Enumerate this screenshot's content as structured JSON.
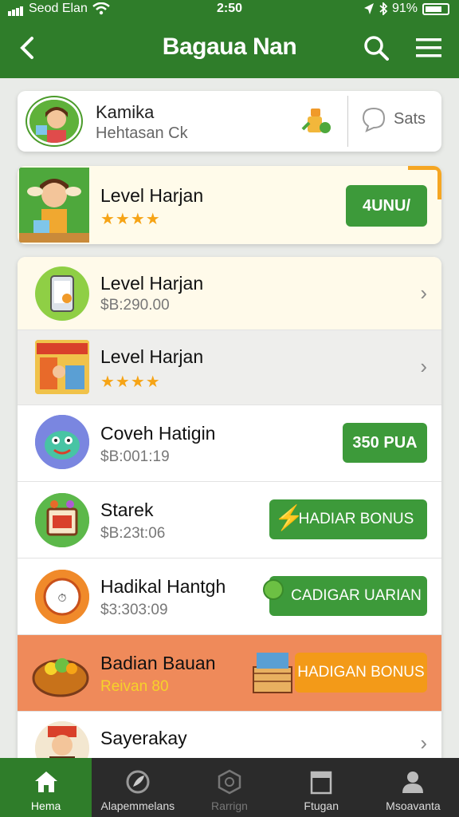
{
  "status": {
    "carrier": "Seod Elan",
    "time": "2:50",
    "battery": "91%"
  },
  "header": {
    "title": "Bagaua Nan"
  },
  "profile": {
    "name": "Kamika",
    "subtitle": "Hehtasan Ck",
    "sats_label": "Sats"
  },
  "featured": {
    "title": "Level Harjan",
    "rating": 4,
    "button_label": "4UNU/"
  },
  "list": [
    {
      "title": "Level Harjan",
      "subtitle": "$B:290.00",
      "action": "chevron"
    },
    {
      "title": "Level Harjan",
      "rating": 4,
      "action": "chevron"
    },
    {
      "title": "Coveh Hatigin",
      "subtitle": "$B:001:19",
      "button_label": "350 PUA"
    },
    {
      "title": "Starek",
      "subtitle": "$B:23t:06",
      "button_label": "HADIAR BONUS"
    },
    {
      "title": "Hadikal Hantgh",
      "subtitle": "$3:303:09",
      "button_label": "CADIGAR UARIAN"
    },
    {
      "title": "Badian Bauan",
      "subtitle": "Reivan 80",
      "button_label": "HADIGAN BONUS"
    },
    {
      "title": "Sayerakay",
      "action": "chevron"
    }
  ],
  "nav": [
    {
      "label": "Hema",
      "icon": "home-icon"
    },
    {
      "label": "Alapemmelans",
      "icon": "leaf-icon"
    },
    {
      "label": "Rarrign",
      "icon": "hexagon-icon"
    },
    {
      "label": "Ftugan",
      "icon": "box-icon"
    },
    {
      "label": "Msoavanta",
      "icon": "user-icon"
    }
  ],
  "colors": {
    "primary_green": "#2f7d2a",
    "button_green": "#3d9a3a",
    "highlight_orange": "#ef8a5a",
    "star": "#f6a416"
  }
}
